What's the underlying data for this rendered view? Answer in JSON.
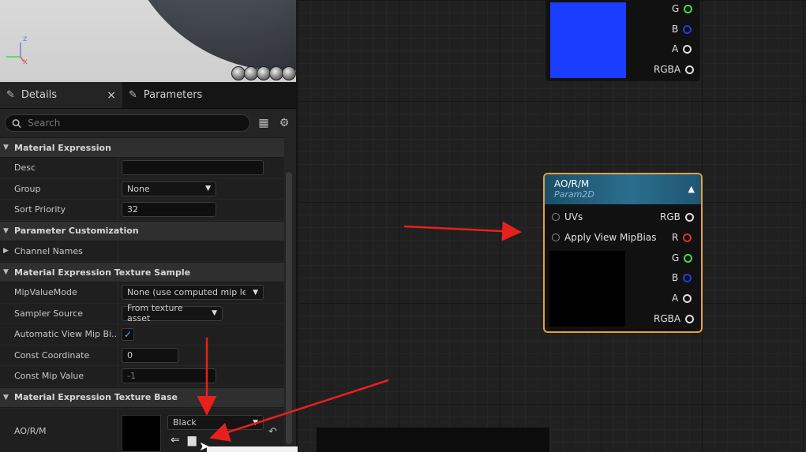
{
  "viewport": {
    "axis_z": "z",
    "axis_x": "x"
  },
  "details_panel": {
    "tabs": [
      {
        "label": "Details",
        "close": "×"
      },
      {
        "label": "Parameters"
      }
    ],
    "search_placeholder": "Search",
    "sections": {
      "material_expression": "Material Expression",
      "parameter_customization": "Parameter Customization",
      "texture_sample": "Material Expression Texture Sample",
      "texture_base": "Material Expression Texture Base"
    },
    "rows": {
      "desc": {
        "label": "Desc",
        "value": ""
      },
      "group": {
        "label": "Group",
        "value": "None"
      },
      "sort_priority": {
        "label": "Sort Priority",
        "value": "32"
      },
      "channel_names": {
        "label": "Channel Names"
      },
      "mip_value_mode": {
        "label": "MipValueMode",
        "value": "None (use computed mip leve"
      },
      "sampler_source": {
        "label": "Sampler Source",
        "value": "From texture asset"
      },
      "auto_view_mip": {
        "label": "Automatic View Mip Bi...",
        "checked": true
      },
      "const_coordinate": {
        "label": "Const Coordinate",
        "value": "0"
      },
      "const_mip_value": {
        "label": "Const Mip Value",
        "value": "-1"
      }
    },
    "texture": {
      "label": "AO/R/M",
      "selected": "Black"
    }
  },
  "graph": {
    "top_node_pins": [
      "G",
      "B",
      "A",
      "RGBA"
    ],
    "main_node": {
      "title": "AO/R/M",
      "subtitle": "Param2D",
      "inputs": [
        "UVs",
        "Apply View MipBias"
      ],
      "outputs": [
        "RGB",
        "R",
        "G",
        "B",
        "A",
        "RGBA"
      ]
    }
  },
  "colors": {
    "accent_orange": "#e3a33a",
    "swatch_blue": "#1b3dff",
    "pin_green": "#3ddc4a",
    "pin_red": "#e0302a",
    "pin_blue": "#2a3ae0",
    "annotation_red": "#e8201c"
  }
}
